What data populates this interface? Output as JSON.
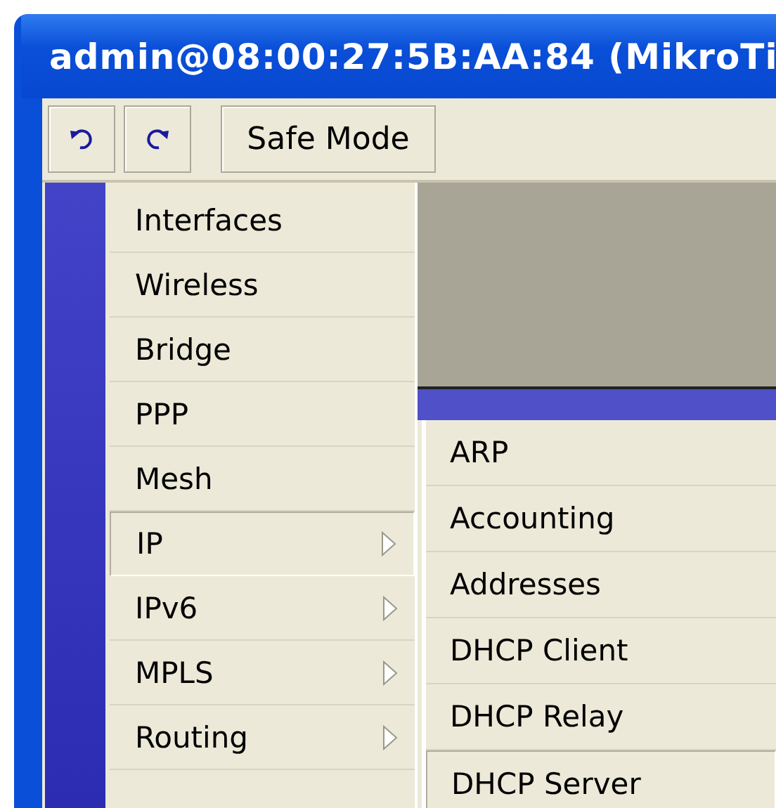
{
  "window": {
    "title": "admin@08:00:27:5B:AA:84 (MikroTi"
  },
  "toolbar": {
    "buttons": [
      {
        "kind": "undo"
      },
      {
        "kind": "redo"
      },
      {
        "kind": "text",
        "label": "Safe Mode"
      }
    ]
  },
  "menu": {
    "items": [
      {
        "label": "Interfaces",
        "submenu": false,
        "selected": false
      },
      {
        "label": "Wireless",
        "submenu": false,
        "selected": false
      },
      {
        "label": "Bridge",
        "submenu": false,
        "selected": false
      },
      {
        "label": "PPP",
        "submenu": false,
        "selected": false
      },
      {
        "label": "Mesh",
        "submenu": false,
        "selected": false
      },
      {
        "label": "IP",
        "submenu": true,
        "selected": true
      },
      {
        "label": "IPv6",
        "submenu": true,
        "selected": false
      },
      {
        "label": "MPLS",
        "submenu": true,
        "selected": false
      },
      {
        "label": "Routing",
        "submenu": true,
        "selected": false
      }
    ]
  },
  "submenu": {
    "items": [
      {
        "label": "ARP",
        "selected": false
      },
      {
        "label": "Accounting",
        "selected": false
      },
      {
        "label": "Addresses",
        "selected": false
      },
      {
        "label": "DHCP Client",
        "selected": false
      },
      {
        "label": "DHCP Relay",
        "selected": false
      },
      {
        "label": "DHCP Server",
        "selected": true
      }
    ]
  }
}
